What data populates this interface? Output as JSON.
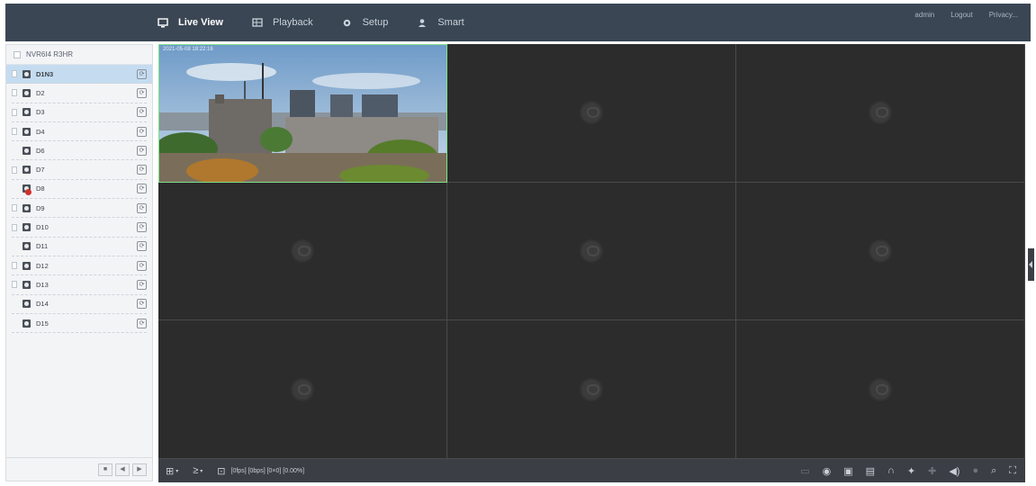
{
  "nav": {
    "items": [
      {
        "label": "Live View",
        "icon": "monitor-icon",
        "active": true
      },
      {
        "label": "Playback",
        "icon": "film-icon",
        "active": false
      },
      {
        "label": "Setup",
        "icon": "gear-icon",
        "active": false
      },
      {
        "label": "Smart",
        "icon": "person-icon",
        "active": false
      }
    ],
    "user": "admin",
    "logout": "Logout",
    "privacy": "Privacy..."
  },
  "sidebar": {
    "device_name": "NVR6I4 R3HR",
    "cameras": [
      {
        "name": "D1N3",
        "selected": true,
        "checkbox": true,
        "error": false
      },
      {
        "name": "D2",
        "selected": false,
        "checkbox": true,
        "error": false
      },
      {
        "name": "D3",
        "selected": false,
        "checkbox": true,
        "error": false
      },
      {
        "name": "D4",
        "selected": false,
        "checkbox": true,
        "error": false
      },
      {
        "name": "D6",
        "selected": false,
        "checkbox": false,
        "error": false
      },
      {
        "name": "D7",
        "selected": false,
        "checkbox": true,
        "error": false
      },
      {
        "name": "D8",
        "selected": false,
        "checkbox": false,
        "error": true
      },
      {
        "name": "D9",
        "selected": false,
        "checkbox": true,
        "error": false
      },
      {
        "name": "D10",
        "selected": false,
        "checkbox": true,
        "error": false
      },
      {
        "name": "D11",
        "selected": false,
        "checkbox": false,
        "error": false
      },
      {
        "name": "D12",
        "selected": false,
        "checkbox": true,
        "error": false
      },
      {
        "name": "D13",
        "selected": false,
        "checkbox": true,
        "error": false
      },
      {
        "name": "D14",
        "selected": false,
        "checkbox": false,
        "error": false
      },
      {
        "name": "D15",
        "selected": false,
        "checkbox": false,
        "error": false
      }
    ],
    "footer_buttons": [
      "stop-all-icon",
      "prev-page-icon",
      "next-page-icon"
    ]
  },
  "live": {
    "osd_text": "2021-05-08 18:22:16",
    "tiles_count": 9
  },
  "toolbar": {
    "stats": "[0fps] [0bps] [0×0] [0.00%]",
    "left_icons": [
      "layout-grid-icon",
      "stream-icon",
      "lock-icon"
    ],
    "right_icons": [
      "keyboard-icon",
      "speedometer-icon",
      "snapshot-icon",
      "record-icon",
      "audio-icon",
      "ptz-icon",
      "zoom-icon",
      "volume-icon",
      "mic-icon",
      "digital-zoom-icon",
      "fullscreen-icon"
    ]
  },
  "colors": {
    "topbar": "#3b4654",
    "selected_row": "#c5dcf0",
    "live_border": "#7fe08a",
    "error": "#d0312d"
  }
}
